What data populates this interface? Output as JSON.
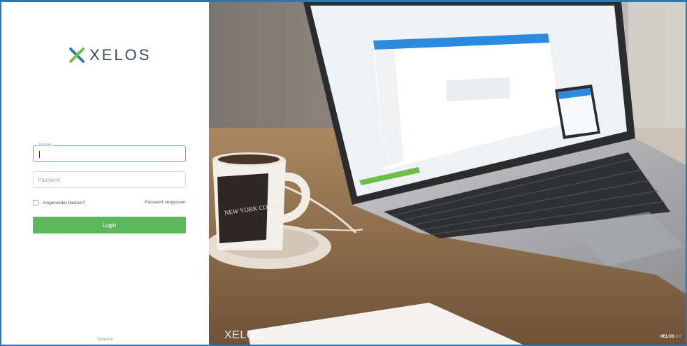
{
  "app": {
    "logo_text": "XELOS"
  },
  "login": {
    "username_label": "Nutzer",
    "username_value": "",
    "password_placeholder": "Passwort",
    "remember_label": "Angemeldet bleiben?",
    "forgot_link": "Passwort vergessen",
    "login_button": "Login",
    "language_link": "Sprache"
  },
  "hero": {
    "brand_text": "XELOS",
    "version_brand": "XELOS",
    "version_number": "9.0",
    "mug_text": "NEW YORK COFFEE"
  },
  "colors": {
    "accent_blue": "#5b9bd5",
    "login_green": "#5cb85c",
    "logo_dark": "#3c4a5a",
    "logo_blue": "#2a7ab8",
    "logo_green": "#6cc04a"
  }
}
